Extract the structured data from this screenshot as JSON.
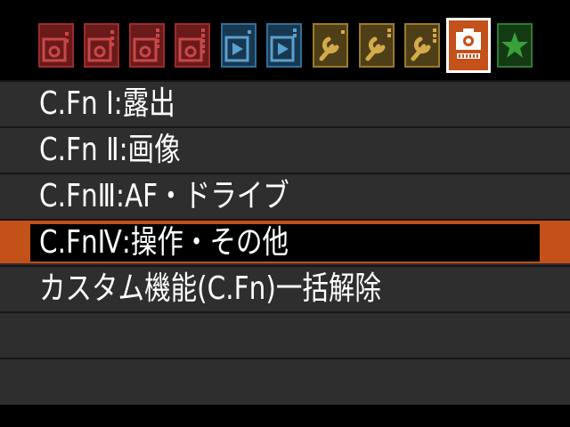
{
  "tabs": [
    {
      "icon": "shooting-1-camera-icon",
      "color": "#9a2c2c"
    },
    {
      "icon": "shooting-2-camera-icon",
      "color": "#9a2c2c"
    },
    {
      "icon": "shooting-3-camera-icon",
      "color": "#9a2c2c"
    },
    {
      "icon": "shooting-4-camera-icon",
      "color": "#9a2c2c"
    },
    {
      "icon": "playback-1-icon",
      "color": "#2f6f9a"
    },
    {
      "icon": "playback-2-icon",
      "color": "#2f6f9a"
    },
    {
      "icon": "setup-1-wrench-icon",
      "color": "#9a7a2c"
    },
    {
      "icon": "setup-2-wrench-icon",
      "color": "#9a7a2c"
    },
    {
      "icon": "setup-3-wrench-icon",
      "color": "#9a7a2c"
    },
    {
      "icon": "custom-functions-camera-icon",
      "color": "#c4501a",
      "selected": true
    },
    {
      "icon": "my-menu-star-icon",
      "color": "#2f7a2f"
    }
  ],
  "menu": {
    "items": [
      {
        "label": "C.Fn Ⅰ:露出"
      },
      {
        "label": "C.Fn Ⅱ:画像"
      },
      {
        "label": "C.FnⅢ:AF・ドライブ"
      },
      {
        "label": "C.FnⅣ:操作・その他",
        "selected": true
      },
      {
        "label": "カスタム機能(C.Fn)一括解除"
      },
      {
        "label": ""
      },
      {
        "label": ""
      }
    ]
  },
  "colors": {
    "accent": "#c4501a",
    "row_bg": "#2e2e2e",
    "highlight_bg": "#000000",
    "text": "#ffffff"
  }
}
